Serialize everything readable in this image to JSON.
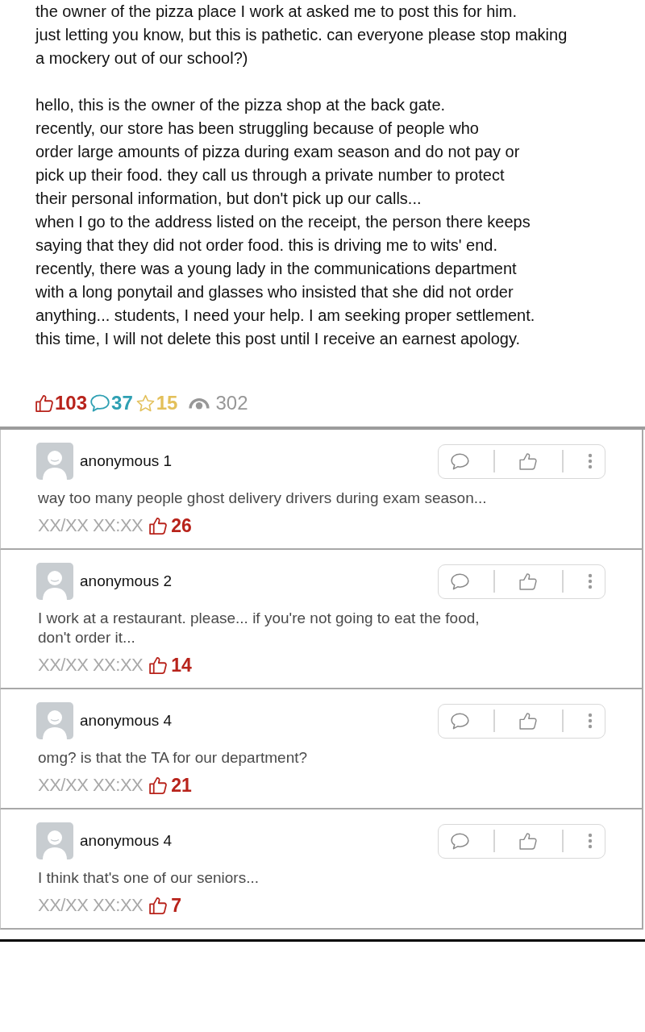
{
  "post": {
    "paragraphs": [
      [
        "the owner of the pizza place I work at asked me to post this for him.",
        "just letting you know, but this is pathetic. can everyone please stop making",
        "a mockery out of our school?)"
      ],
      [
        "hello, this is the owner of the pizza shop at the back gate.",
        "recently, our store has been struggling because of people who",
        "order large amounts of pizza during exam season and do not pay or",
        "pick up their food. they call us through a private number to protect",
        "their personal information, but don't pick up our calls...",
        "when I go to the address listed on the receipt, the person there keeps",
        "saying that they did not order food. this is driving me to wits' end.",
        "recently, there was a young lady in the communications department",
        "with a long ponytail and glasses who insisted that she did not order",
        "anything... students, I need your help. I am seeking proper settlement.",
        "this time, I will not delete this post until I receive an earnest apology."
      ]
    ]
  },
  "stats": [
    {
      "kind": "like",
      "count": "103"
    },
    {
      "kind": "comment",
      "count": "37"
    },
    {
      "kind": "star",
      "count": "15"
    },
    {
      "kind": "view",
      "count": "302"
    }
  ],
  "comments": [
    {
      "author": "anonymous 1",
      "lines": [
        "way too many people ghost delivery drivers during exam season..."
      ],
      "time": "XX/XX XX:XX",
      "likes": "26"
    },
    {
      "author": "anonymous 2",
      "lines": [
        "I work at a restaurant. please... if you're not going to eat the food,",
        "don't order it..."
      ],
      "time": "XX/XX XX:XX",
      "likes": "14"
    },
    {
      "author": "anonymous 4",
      "lines": [
        "omg? is that the TA for our department?"
      ],
      "time": "XX/XX XX:XX",
      "likes": "21"
    },
    {
      "author": "anonymous 4",
      "lines": [
        "I think that's one of our seniors..."
      ],
      "time": "XX/XX XX:XX",
      "likes": "7"
    }
  ]
}
